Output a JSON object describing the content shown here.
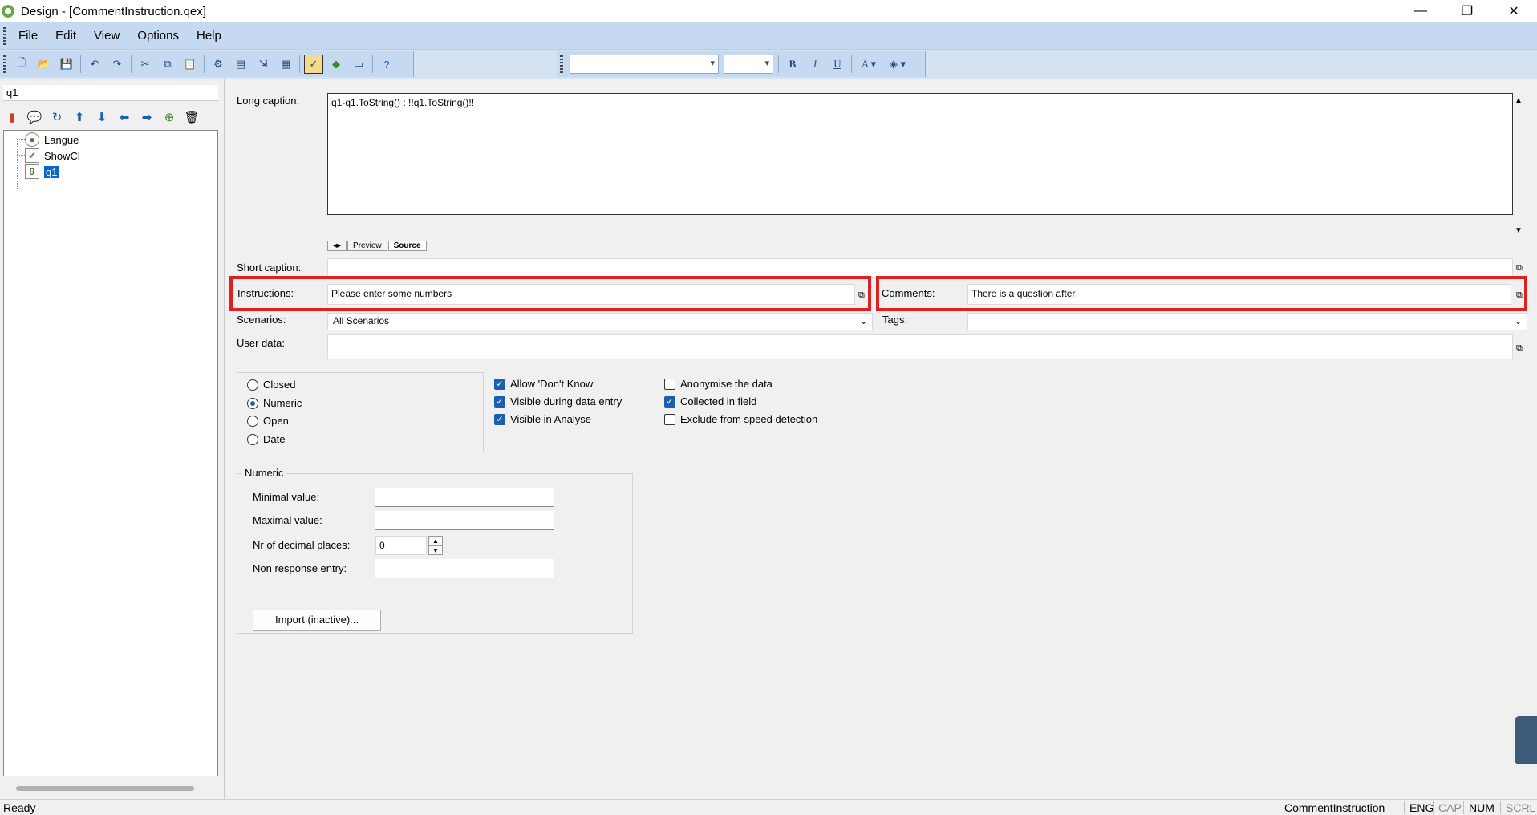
{
  "window": {
    "title": "Design - [CommentInstruction.qex]",
    "minimize": "—",
    "restore": "❐",
    "close": "✕"
  },
  "menu": [
    "File",
    "Edit",
    "View",
    "Options",
    "Help"
  ],
  "left": {
    "search_value": "q1",
    "tree": [
      {
        "label": "Langue",
        "icon": "radio-icon"
      },
      {
        "label": "ShowCl",
        "icon": "check-icon"
      },
      {
        "label": "q1",
        "icon": "numeric-icon"
      }
    ]
  },
  "editor": {
    "long_caption_label": "Long caption:",
    "long_caption_value": "q1-q1.ToString() : !!q1.ToString()!!",
    "tab_preview": "Preview",
    "tab_source": "Source",
    "short_caption_label": "Short caption:",
    "short_caption_value": "",
    "instructions_label": "Instructions:",
    "instructions_value": "Please enter some numbers",
    "comments_label": "Comments:",
    "comments_value": "There is a question after",
    "scenarios_label": "Scenarios:",
    "scenarios_value": "All Scenarios",
    "tags_label": "Tags:",
    "tags_value": "",
    "user_data_label": "User data:",
    "user_data_value": ""
  },
  "question_types": [
    {
      "label": "Closed",
      "selected": false
    },
    {
      "label": "Numeric",
      "selected": true
    },
    {
      "label": "Open",
      "selected": false
    },
    {
      "label": "Date",
      "selected": false
    }
  ],
  "options_col1": [
    {
      "label": "Allow 'Don't Know'",
      "checked": true
    },
    {
      "label": "Visible during data entry",
      "checked": true
    },
    {
      "label": "Visible in Analyse",
      "checked": true
    }
  ],
  "options_col2": [
    {
      "label": "Anonymise the data",
      "checked": false
    },
    {
      "label": "Collected in field",
      "checked": true
    },
    {
      "label": "Exclude from speed detection",
      "checked": false
    }
  ],
  "numeric": {
    "group_label": "Numeric",
    "min_label": "Minimal value:",
    "min_value": "",
    "max_label": "Maximal value:",
    "max_value": "",
    "decimals_label": "Nr of decimal places:",
    "decimals_value": "0",
    "nonresponse_label": "Non response entry:",
    "nonresponse_value": "",
    "import_button": "Import (inactive)..."
  },
  "status": {
    "ready": "Ready",
    "file": "CommentInstruction",
    "lang": "ENG",
    "cap": "CAP",
    "num": "NUM",
    "scrl": "SCRL"
  },
  "colors": {
    "accent": "#1a5fb4",
    "highlight_box": "#e02020",
    "menubar": "#c5d9f1"
  }
}
